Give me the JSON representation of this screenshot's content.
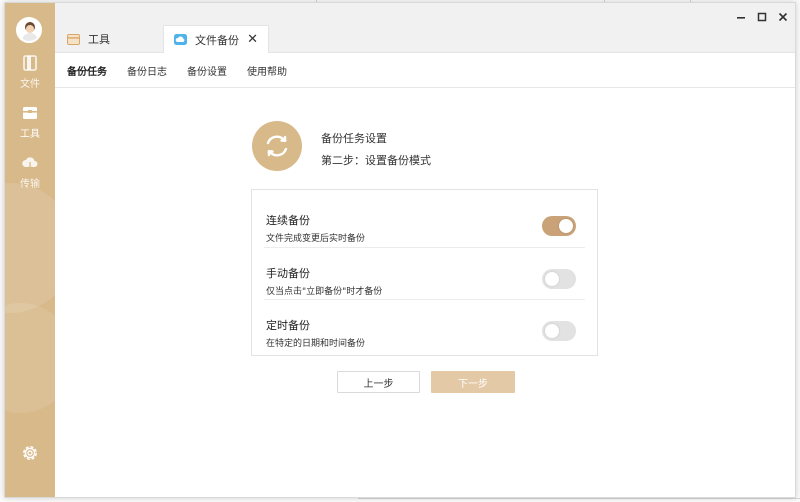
{
  "sidebar": {
    "items": [
      {
        "label": "文件",
        "icon": "file-icon"
      },
      {
        "label": "工具",
        "icon": "toolbox-icon"
      },
      {
        "label": "传输",
        "icon": "cloud-transfer-icon"
      }
    ],
    "active": "工具",
    "settings_icon": "gear-icon",
    "brand_color": "#d8b98a"
  },
  "tabs": [
    {
      "label": "工具",
      "icon": "toolbox-icon"
    },
    {
      "label": "文件备份",
      "icon": "backup-icon",
      "active": true
    }
  ],
  "subnav": [
    {
      "label": "备份任务",
      "active": true
    },
    {
      "label": "备份日志"
    },
    {
      "label": "备份设置"
    },
    {
      "label": "使用帮助"
    }
  ],
  "hero": {
    "title": "备份任务设置",
    "subtitle": "第二步：设置备份模式",
    "icon": "sync-icon"
  },
  "modes": [
    {
      "title": "连续备份",
      "desc": "文件完成变更后实时备份",
      "enabled": true
    },
    {
      "title": "手动备份",
      "desc": "仅当点击\"立即备份\"时才备份",
      "enabled": false
    },
    {
      "title": "定时备份",
      "desc": "在特定的日期和时间备份",
      "enabled": false
    }
  ],
  "buttons": {
    "prev": "上一步",
    "next": "下一步"
  },
  "colors": {
    "accent": "#c9a277",
    "next_button": "#e3c9a5"
  }
}
